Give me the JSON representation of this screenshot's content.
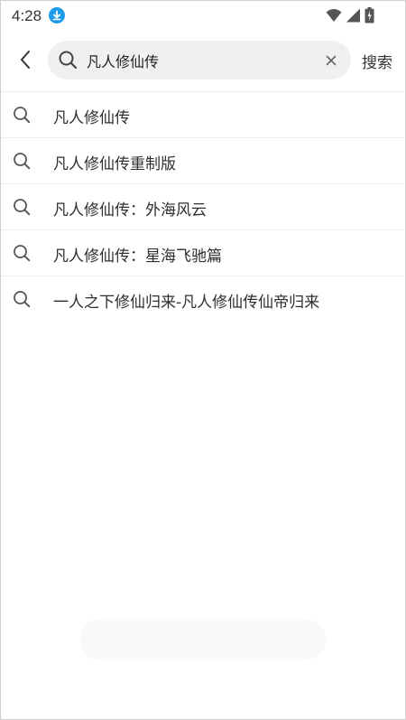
{
  "status_bar": {
    "time": "4:28",
    "icons": [
      "download-icon",
      "wifi-icon",
      "cellular-signal-icon",
      "battery-charging-icon"
    ]
  },
  "search": {
    "query": "凡人修仙传",
    "placeholder": "",
    "submit_label": "搜索",
    "back_icon": "chevron-left-icon",
    "clear_icon": "close-icon",
    "search_icon": "search-icon"
  },
  "suggestions": [
    {
      "label": "凡人修仙传"
    },
    {
      "label": "凡人修仙传重制版"
    },
    {
      "label": "凡人修仙传：外海风云"
    },
    {
      "label": "凡人修仙传：星海飞驰篇"
    },
    {
      "label": "一人之下修仙归来-凡人修仙传仙帝归来"
    }
  ],
  "colors": {
    "accent": "#1e9be9",
    "search_box_bg": "#f0f0f0",
    "divider": "#ececec"
  }
}
